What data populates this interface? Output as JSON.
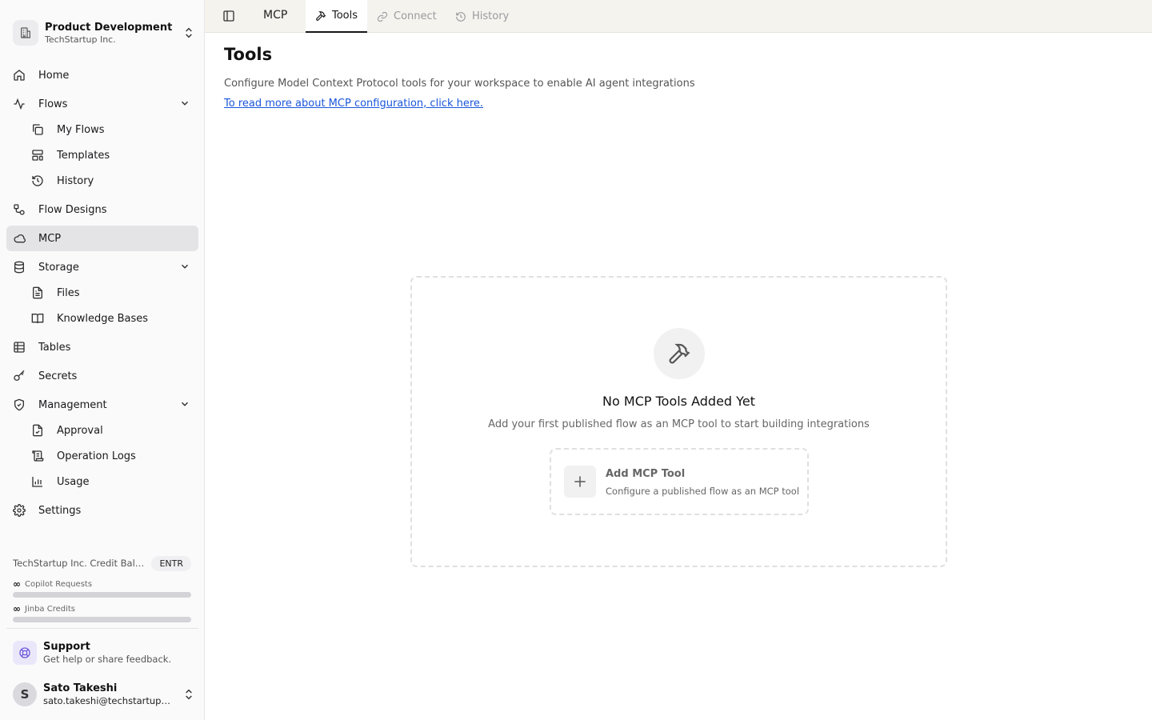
{
  "org": {
    "name": "Product Development",
    "company": "TechStartup Inc."
  },
  "sidebar": {
    "home": "Home",
    "flows": "Flows",
    "my_flows": "My Flows",
    "templates": "Templates",
    "history": "History",
    "flow_designs": "Flow Designs",
    "mcp": "MCP",
    "storage": "Storage",
    "files": "Files",
    "knowledge_bases": "Knowledge Bases",
    "tables": "Tables",
    "secrets": "Secrets",
    "management": "Management",
    "approval": "Approval",
    "operation_logs": "Operation Logs",
    "usage": "Usage",
    "settings": "Settings"
  },
  "credits": {
    "title": "TechStartup Inc. Credit Balance",
    "plan_badge": "ENTR",
    "infinity_symbol": "∞",
    "meters": [
      {
        "label": "Copilot Requests"
      },
      {
        "label": "Jinba Credits"
      }
    ]
  },
  "support": {
    "title": "Support",
    "subtitle": "Get help or share feedback."
  },
  "user": {
    "initial": "S",
    "name": "Sato Takeshi",
    "email": "sato.takeshi@techstartup.com"
  },
  "topbar": {
    "breadcrumb": "MCP",
    "tabs": [
      {
        "label": "Tools",
        "active": true
      },
      {
        "label": "Connect",
        "active": false
      },
      {
        "label": "History",
        "active": false
      }
    ]
  },
  "main": {
    "title": "Tools",
    "description": "Configure Model Context Protocol tools for your workspace to enable AI agent integrations",
    "link_text": "To read more about MCP configuration, click here.",
    "empty_state": {
      "title": "No MCP Tools Added Yet",
      "subtitle": "Add your first published flow as an MCP tool to start building integrations",
      "add_title": "Add MCP Tool",
      "add_subtitle": "Configure a published flow as an MCP tool"
    }
  },
  "colors": {
    "link": "#1a56db",
    "active_nav": "#e4e4e7",
    "support_accent": "#6d5ad9",
    "topbar_bg": "#f5f3ee"
  }
}
